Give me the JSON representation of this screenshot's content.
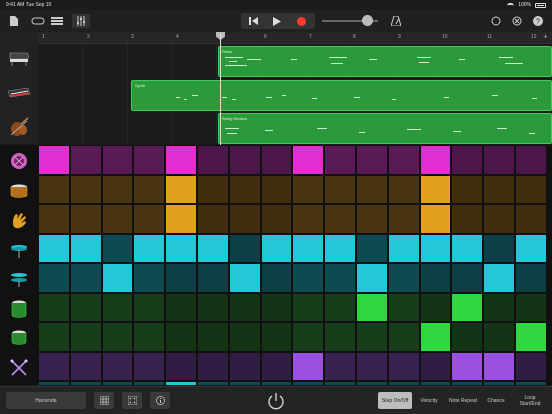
{
  "status": {
    "time": "9:41 AM",
    "date": "Tue Sep 10",
    "battery": "100%"
  },
  "toolbar": {
    "icons": [
      "browser-icon",
      "loop-icon",
      "tracks-view-icon",
      "mixer-icon",
      "rewind-icon",
      "play-icon",
      "record-icon",
      "metronome-icon",
      "loop-browser-icon",
      "settings-icon",
      "help-icon"
    ],
    "record_color": "#ff3b30"
  },
  "ruler": {
    "bars": [
      "1",
      "2",
      "3",
      "4",
      "5",
      "6",
      "7",
      "8",
      "9",
      "10",
      "11",
      "12"
    ]
  },
  "tracks": [
    {
      "name": "Piano",
      "icon": "piano-icon"
    },
    {
      "name": "Synth",
      "icon": "synth-keyboard-icon"
    },
    {
      "name": "String Section",
      "icon": "violin-icon"
    }
  ],
  "sequencer": {
    "rows": [
      {
        "icon": "kick-drum-icon",
        "color_on": "#e02ed0",
        "color_off": "#5a1a55",
        "steps": [
          1,
          0,
          0,
          0,
          1,
          0,
          0,
          0,
          1,
          0,
          0,
          0,
          1,
          0,
          0,
          0
        ]
      },
      {
        "icon": "snare-drum-icon",
        "color_on": "#e0a020",
        "color_off": "#4a3510",
        "steps": [
          0,
          0,
          0,
          0,
          1,
          0,
          0,
          0,
          0,
          0,
          0,
          0,
          1,
          0,
          0,
          0
        ]
      },
      {
        "icon": "clap-icon",
        "color_on": "#e0a020",
        "color_off": "#4a3510",
        "steps": [
          0,
          0,
          0,
          0,
          1,
          0,
          0,
          0,
          0,
          0,
          0,
          0,
          1,
          0,
          0,
          0
        ]
      },
      {
        "icon": "closed-hihat-icon",
        "color_on": "#22c8d8",
        "color_off": "#0e4a52",
        "steps": [
          1,
          1,
          0,
          1,
          1,
          1,
          0,
          1,
          1,
          1,
          0,
          1,
          1,
          1,
          0,
          1
        ]
      },
      {
        "icon": "open-hihat-icon",
        "color_on": "#22c8d8",
        "color_off": "#0e4a52",
        "steps": [
          0,
          0,
          1,
          0,
          0,
          0,
          1,
          0,
          0,
          0,
          1,
          0,
          0,
          0,
          1,
          0
        ]
      },
      {
        "icon": "tom-low-icon",
        "color_on": "#30d840",
        "color_off": "#173d1a",
        "steps": [
          0,
          0,
          0,
          0,
          0,
          0,
          0,
          0,
          0,
          0,
          1,
          0,
          0,
          1,
          0,
          0
        ]
      },
      {
        "icon": "tom-high-icon",
        "color_on": "#30d840",
        "color_off": "#173d1a",
        "steps": [
          0,
          0,
          0,
          0,
          0,
          0,
          0,
          0,
          0,
          0,
          0,
          0,
          1,
          0,
          0,
          1
        ]
      },
      {
        "icon": "sticks-icon",
        "color_on": "#9a50e0",
        "color_off": "#3a2250",
        "steps": [
          0,
          0,
          0,
          0,
          0,
          0,
          0,
          0,
          1,
          0,
          0,
          0,
          0,
          1,
          1,
          0
        ]
      }
    ]
  },
  "bottom": {
    "kit_name": "Hacienda",
    "modes": [
      {
        "label": "Step On/Off",
        "active": true
      },
      {
        "label": "Velocity",
        "active": false
      },
      {
        "label": "Note Repeat",
        "active": false
      },
      {
        "label": "Chance",
        "active": false
      },
      {
        "label": "Loop Start/End",
        "active": false
      }
    ]
  }
}
